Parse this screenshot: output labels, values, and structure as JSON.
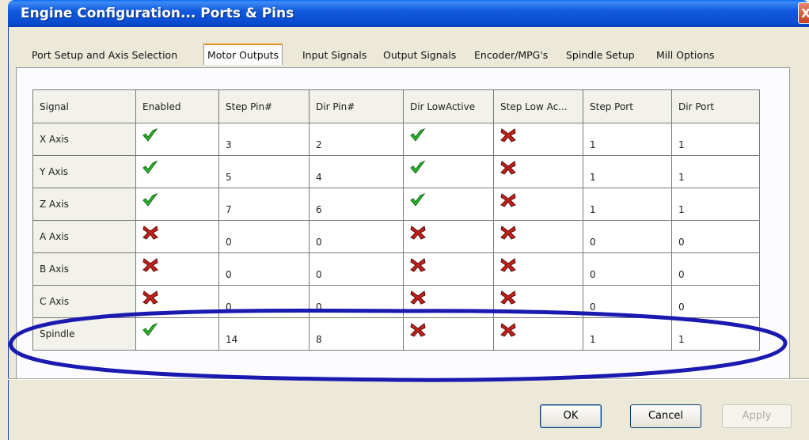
{
  "window": {
    "title": "Engine Configuration... Ports & Pins",
    "close_label": "X"
  },
  "tabs": [
    {
      "label": "Port Setup and Axis Selection",
      "active": false
    },
    {
      "label": "Motor Outputs",
      "active": true
    },
    {
      "label": "Input Signals",
      "active": false
    },
    {
      "label": "Output Signals",
      "active": false
    },
    {
      "label": "Encoder/MPG's",
      "active": false
    },
    {
      "label": "Spindle Setup",
      "active": false
    },
    {
      "label": "Mill Options",
      "active": false
    }
  ],
  "grid": {
    "columns": [
      "Signal",
      "Enabled",
      "Step Pin#",
      "Dir Pin#",
      "Dir LowActive",
      "Step Low Ac...",
      "Step Port",
      "Dir Port"
    ],
    "rows": [
      {
        "signal": "X Axis",
        "enabled": true,
        "step_pin": "3",
        "dir_pin": "2",
        "dir_low_active": true,
        "step_low_active": false,
        "step_port": "1",
        "dir_port": "1"
      },
      {
        "signal": "Y Axis",
        "enabled": true,
        "step_pin": "5",
        "dir_pin": "4",
        "dir_low_active": true,
        "step_low_active": false,
        "step_port": "1",
        "dir_port": "1"
      },
      {
        "signal": "Z Axis",
        "enabled": true,
        "step_pin": "7",
        "dir_pin": "6",
        "dir_low_active": true,
        "step_low_active": false,
        "step_port": "1",
        "dir_port": "1"
      },
      {
        "signal": "A Axis",
        "enabled": false,
        "step_pin": "0",
        "dir_pin": "0",
        "dir_low_active": false,
        "step_low_active": false,
        "step_port": "0",
        "dir_port": "0"
      },
      {
        "signal": "B Axis",
        "enabled": false,
        "step_pin": "0",
        "dir_pin": "0",
        "dir_low_active": false,
        "step_low_active": false,
        "step_port": "0",
        "dir_port": "0"
      },
      {
        "signal": "C Axis",
        "enabled": false,
        "step_pin": "0",
        "dir_pin": "0",
        "dir_low_active": false,
        "step_low_active": false,
        "step_port": "0",
        "dir_port": "0"
      },
      {
        "signal": "Spindle",
        "enabled": true,
        "step_pin": "14",
        "dir_pin": "8",
        "dir_low_active": false,
        "step_low_active": false,
        "step_port": "1",
        "dir_port": "1"
      }
    ]
  },
  "buttons": {
    "ok": "OK",
    "cancel": "Cancel",
    "apply": "Apply"
  },
  "icons": {
    "enabled_true": "green-check-icon",
    "enabled_false": "red-x-icon"
  },
  "colors": {
    "title_bar": "#0a4cd0",
    "check_green": "#2fb52f",
    "x_red": "#c4221c",
    "highlight_ellipse": "#1a1ab0"
  }
}
